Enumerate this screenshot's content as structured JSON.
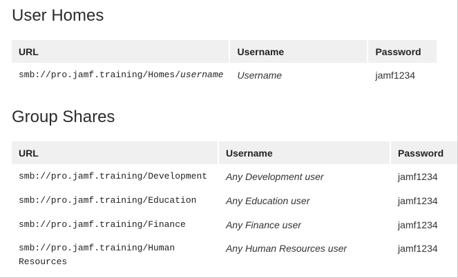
{
  "user_homes": {
    "heading": "User Homes",
    "columns": [
      "URL",
      "Username",
      "Password"
    ],
    "rows": [
      {
        "url_prefix": "smb://pro.jamf.training/Homes/",
        "url_italic": "username",
        "username": "Username",
        "password": "jamf1234"
      }
    ]
  },
  "group_shares": {
    "heading": "Group Shares",
    "columns": [
      "URL",
      "Username",
      "Password"
    ],
    "rows": [
      {
        "url": "smb://pro.jamf.training/Development",
        "username": "Any Development user",
        "password": "jamf1234"
      },
      {
        "url": "smb://pro.jamf.training/Education",
        "username": "Any Education user",
        "password": "jamf1234"
      },
      {
        "url": "smb://pro.jamf.training/Finance",
        "username": "Any Finance user",
        "password": "jamf1234"
      },
      {
        "url_line1": "smb://pro.jamf.training/Human",
        "url_line2": "Resources",
        "username": "Any Human Resources user",
        "password": "jamf1234"
      }
    ]
  }
}
